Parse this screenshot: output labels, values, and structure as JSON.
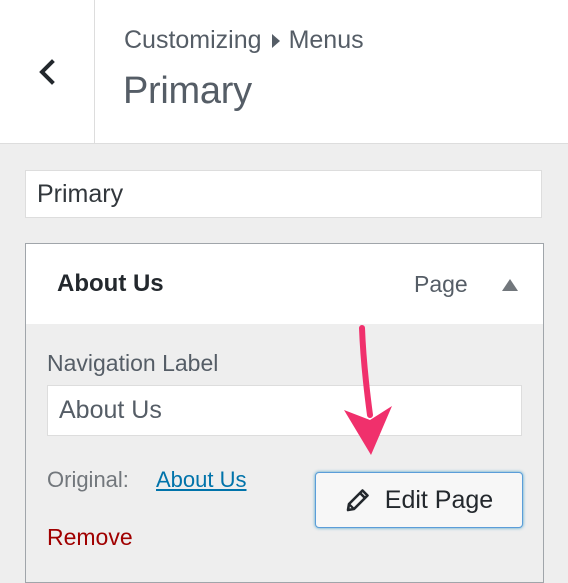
{
  "header": {
    "back_icon": "chevron-left-icon",
    "breadcrumb_parent": "Customizing",
    "breadcrumb_separator_icon": "caret-right-icon",
    "breadcrumb_current": "Menus",
    "title": "Primary"
  },
  "menu_name": {
    "value": "Primary"
  },
  "menu_item": {
    "title": "About Us",
    "type": "Page",
    "toggle_icon": "arrow-up-icon",
    "nav_label_label": "Navigation Label",
    "nav_label_value": "About Us",
    "original_label": "Original:",
    "original_link": "About Us",
    "edit_button_label": "Edit Page",
    "edit_button_icon": "pencil-icon",
    "remove_label": "Remove"
  },
  "annotation": {
    "arrow_color": "#f0306c"
  },
  "colors": {
    "link": "#0073aa",
    "remove": "#a00000",
    "focus_border": "#5b9dd9"
  }
}
